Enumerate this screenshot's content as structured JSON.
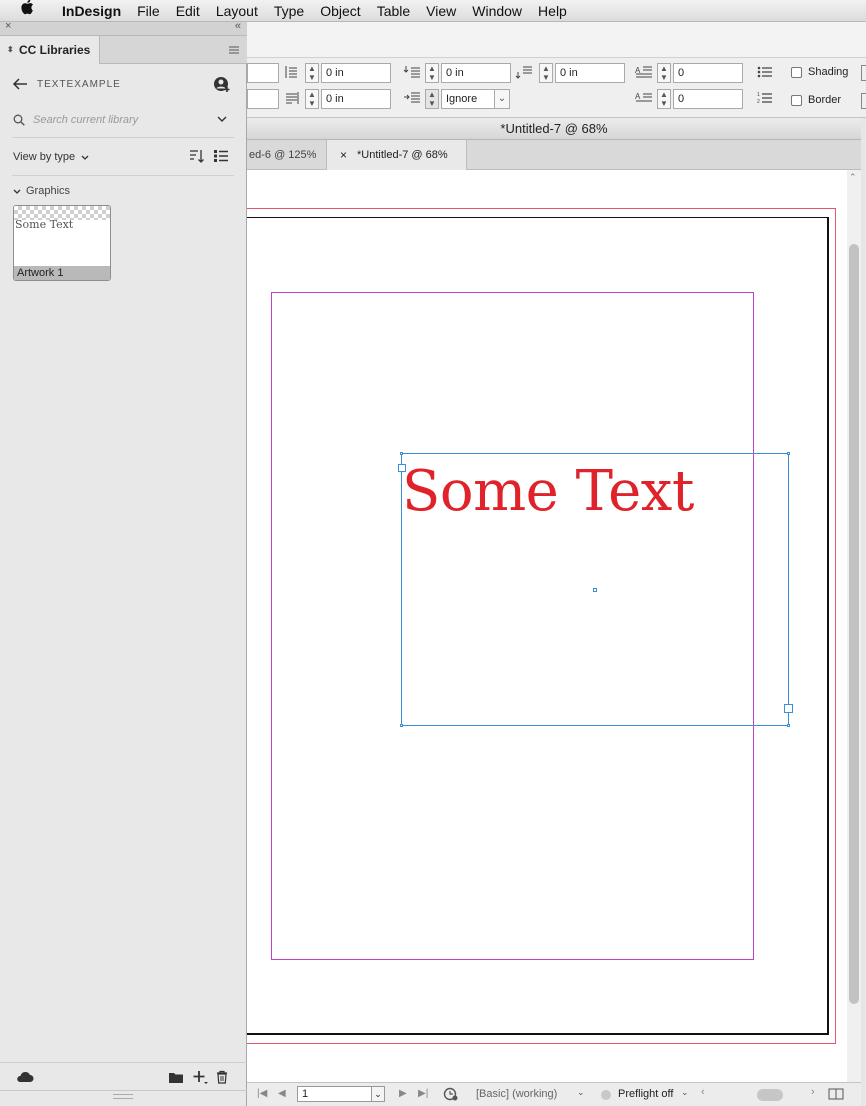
{
  "menubar": {
    "app_name": "InDesign",
    "items": [
      "File",
      "Edit",
      "Layout",
      "Type",
      "Object",
      "Table",
      "View",
      "Window",
      "Help"
    ]
  },
  "control_panel": {
    "indent_left": "0 in",
    "indent_right": "0 in",
    "space_before": "0 in",
    "space_after": "0 in",
    "align_to_grid": "Ignore",
    "drop_cap_lines": "0",
    "drop_cap_chars": "0",
    "shading_label": "Shading",
    "border_label": "Border"
  },
  "document": {
    "window_title": "*Untitled-7 @ 68%",
    "tabs": [
      {
        "label": "ed-6 @ 125%",
        "active": false
      },
      {
        "label": "*Untitled-7 @ 68%",
        "active": true
      }
    ],
    "close_glyph": "×",
    "text_frame_content": "Some Text",
    "text_color": "#e0222a",
    "frame_color": "#3b8fd6",
    "margin_color": "#c040c8",
    "bleed_color": "#e05a6a"
  },
  "statusbar": {
    "page_number": "1",
    "profile": "[Basic] (working)",
    "preflight": "Preflight off"
  },
  "libraries_panel": {
    "tab_title": "CC Libraries",
    "library_name": "TEXTEXAMPLE",
    "search_placeholder": "Search current library",
    "view_by": "View by type",
    "section_title": "Graphics",
    "assets": [
      {
        "name": "Artwork 1",
        "preview_text": "Some Text"
      }
    ]
  }
}
